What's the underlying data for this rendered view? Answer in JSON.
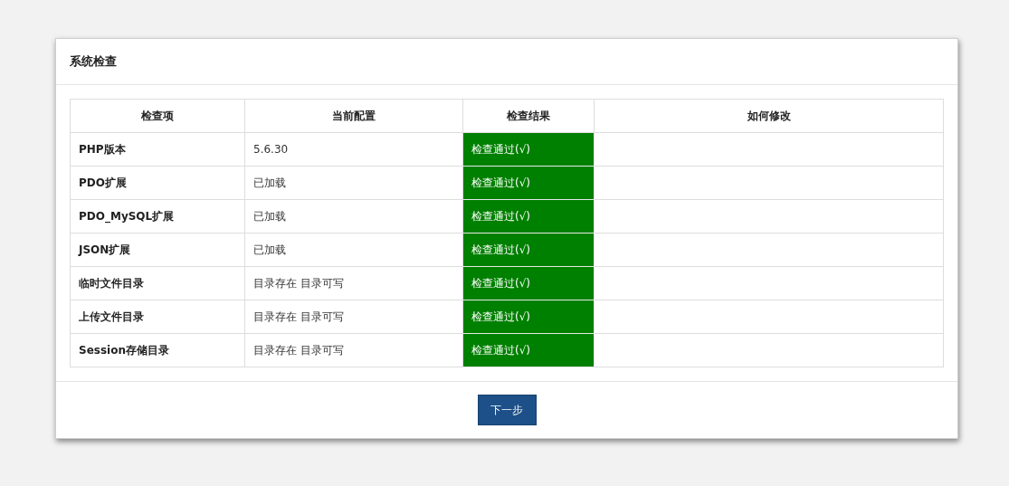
{
  "panel": {
    "title": "系统检查"
  },
  "table": {
    "columns": [
      "检查项",
      "当前配置",
      "检查结果",
      "如何修改"
    ],
    "rows": [
      {
        "item": "PHP版本",
        "config": "5.6.30",
        "result": "检查通过(√)",
        "passed": true
      },
      {
        "item": "PDO扩展",
        "config": "已加载",
        "result": "检查通过(√)",
        "passed": true
      },
      {
        "item": "PDO_MySQL扩展",
        "config": "已加载",
        "result": "检查通过(√)",
        "passed": true
      },
      {
        "item": "JSON扩展",
        "config": "已加载",
        "result": "检查通过(√)",
        "passed": true
      },
      {
        "item": "临时文件目录",
        "config": "目录存在 目录可写",
        "result": "检查通过(√)",
        "passed": true
      },
      {
        "item": "上传文件目录",
        "config": "目录存在 目录可写",
        "result": "检查通过(√)",
        "passed": true
      },
      {
        "item": "Session存储目录",
        "config": "目录存在 目录可写",
        "result": "检查通过(√)",
        "passed": true
      }
    ]
  },
  "next_button": "下一步"
}
